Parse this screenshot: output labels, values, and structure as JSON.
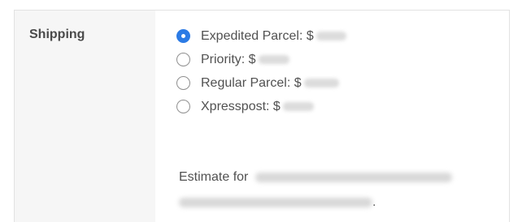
{
  "shipping": {
    "label": "Shipping",
    "options": [
      {
        "label": "Expedited Parcel: $",
        "selected": true
      },
      {
        "label": "Priority: $",
        "selected": false
      },
      {
        "label": "Regular Parcel: $",
        "selected": false
      },
      {
        "label": "Xpresspost: $",
        "selected": false
      }
    ],
    "estimate_prefix": "Estimate for",
    "estimate_suffix": "."
  },
  "colors": {
    "accent": "#2c7be5",
    "label_column_bg": "#f6f6f6",
    "border": "#e2e2e2",
    "text": "#515151"
  }
}
